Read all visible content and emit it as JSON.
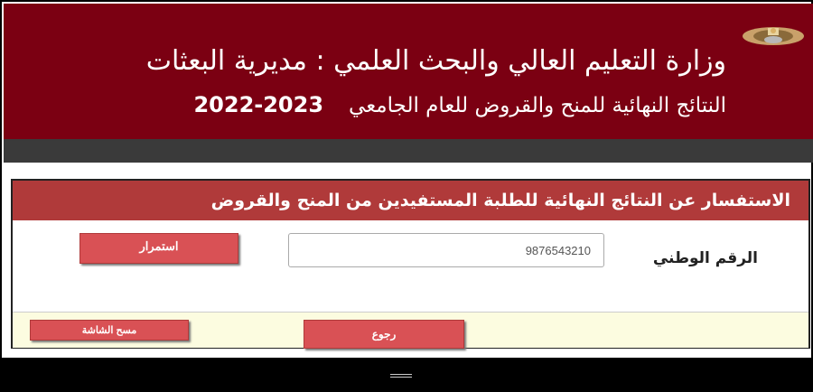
{
  "header": {
    "title": "وزارة التعليم العالي والبحث العلمي : مديرية البعثات",
    "subtitle": "النتائج النهائية للمنح والقروض للعام الجامعي",
    "year": "2022-2023",
    "crest_icon": "jordan-crest-icon",
    "brand_color": "#7b0012"
  },
  "panel": {
    "heading": "الاستفسار عن النتائج النهائية للطلبة المستفيدين من المنح والقروض",
    "national_id_label": "الرقم الوطني",
    "national_id_value": "9876543210",
    "continue_label": "استمرار"
  },
  "footer": {
    "clear_label": "مسح الشاشة",
    "back_label": "رجوع"
  },
  "nav": {
    "menu_icon": "hamburger-icon"
  }
}
